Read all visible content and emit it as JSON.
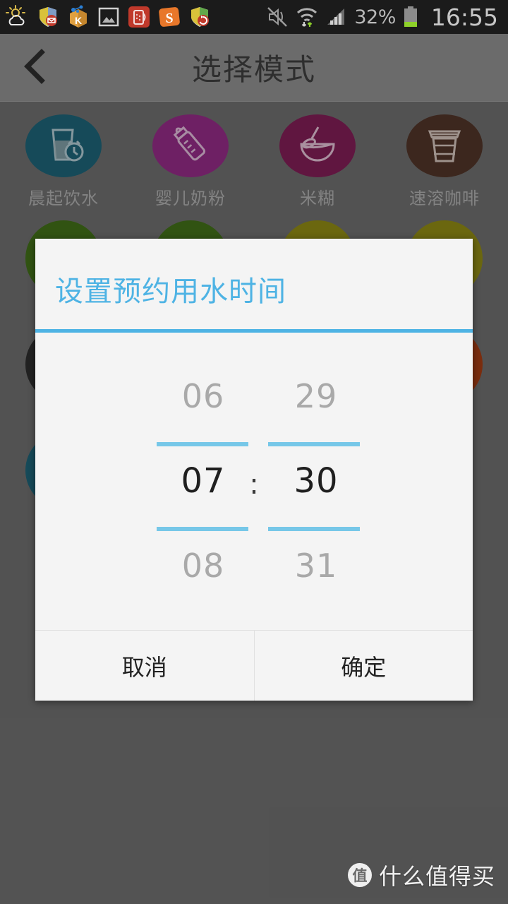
{
  "statusbar": {
    "battery_percent": "32%",
    "clock": "16:55",
    "left_icons": [
      {
        "name": "weather-icon"
      },
      {
        "name": "security-mail-shield-icon"
      },
      {
        "name": "kingsoft-box-icon"
      },
      {
        "name": "gallery-icon"
      },
      {
        "name": "red-app-icon"
      },
      {
        "name": "sogou-s-icon"
      },
      {
        "name": "shield-sync-icon"
      }
    ],
    "right_icons": [
      {
        "name": "mute-vibrate-off-icon"
      },
      {
        "name": "wifi-transfer-icon"
      },
      {
        "name": "signal-bars-icon"
      },
      {
        "name": "battery-icon"
      }
    ]
  },
  "header": {
    "back_label": "‹",
    "title": "选择模式"
  },
  "modes": [
    {
      "label": "晨起饮水",
      "color": "#1d5f72",
      "icon": "glass-alarm-icon"
    },
    {
      "label": "婴儿奶粉",
      "color": "#8e2a80",
      "icon": "baby-bottle-icon"
    },
    {
      "label": "米糊",
      "color": "#7c1d52",
      "icon": "bowl-spoon-icon"
    },
    {
      "label": "速溶咖啡",
      "color": "#4e3227",
      "icon": "coffee-cup-icon"
    },
    {
      "label": "",
      "color": "#3f6b18",
      "icon": "hidden-mode-icon"
    },
    {
      "label": "",
      "color": "#8a8414",
      "icon": "hidden-mode-icon"
    },
    {
      "label": "",
      "color": "#2c2c2c",
      "icon": "hidden-mode-icon"
    },
    {
      "label": "",
      "color": "#9e3a12",
      "icon": "hidden-mode-icon"
    },
    {
      "label": "",
      "color": "#1d5f72",
      "icon": "hidden-mode-icon"
    }
  ],
  "dialog": {
    "title": "设置预约用水时间",
    "accent_color": "#4eb3e4",
    "separator": ":",
    "hour": {
      "prev": "06",
      "current": "07",
      "next": "08"
    },
    "minute": {
      "prev": "29",
      "current": "30",
      "next": "31"
    },
    "cancel_label": "取消",
    "confirm_label": "确定"
  },
  "watermark": {
    "badge": "值",
    "text": "什么值得买"
  }
}
